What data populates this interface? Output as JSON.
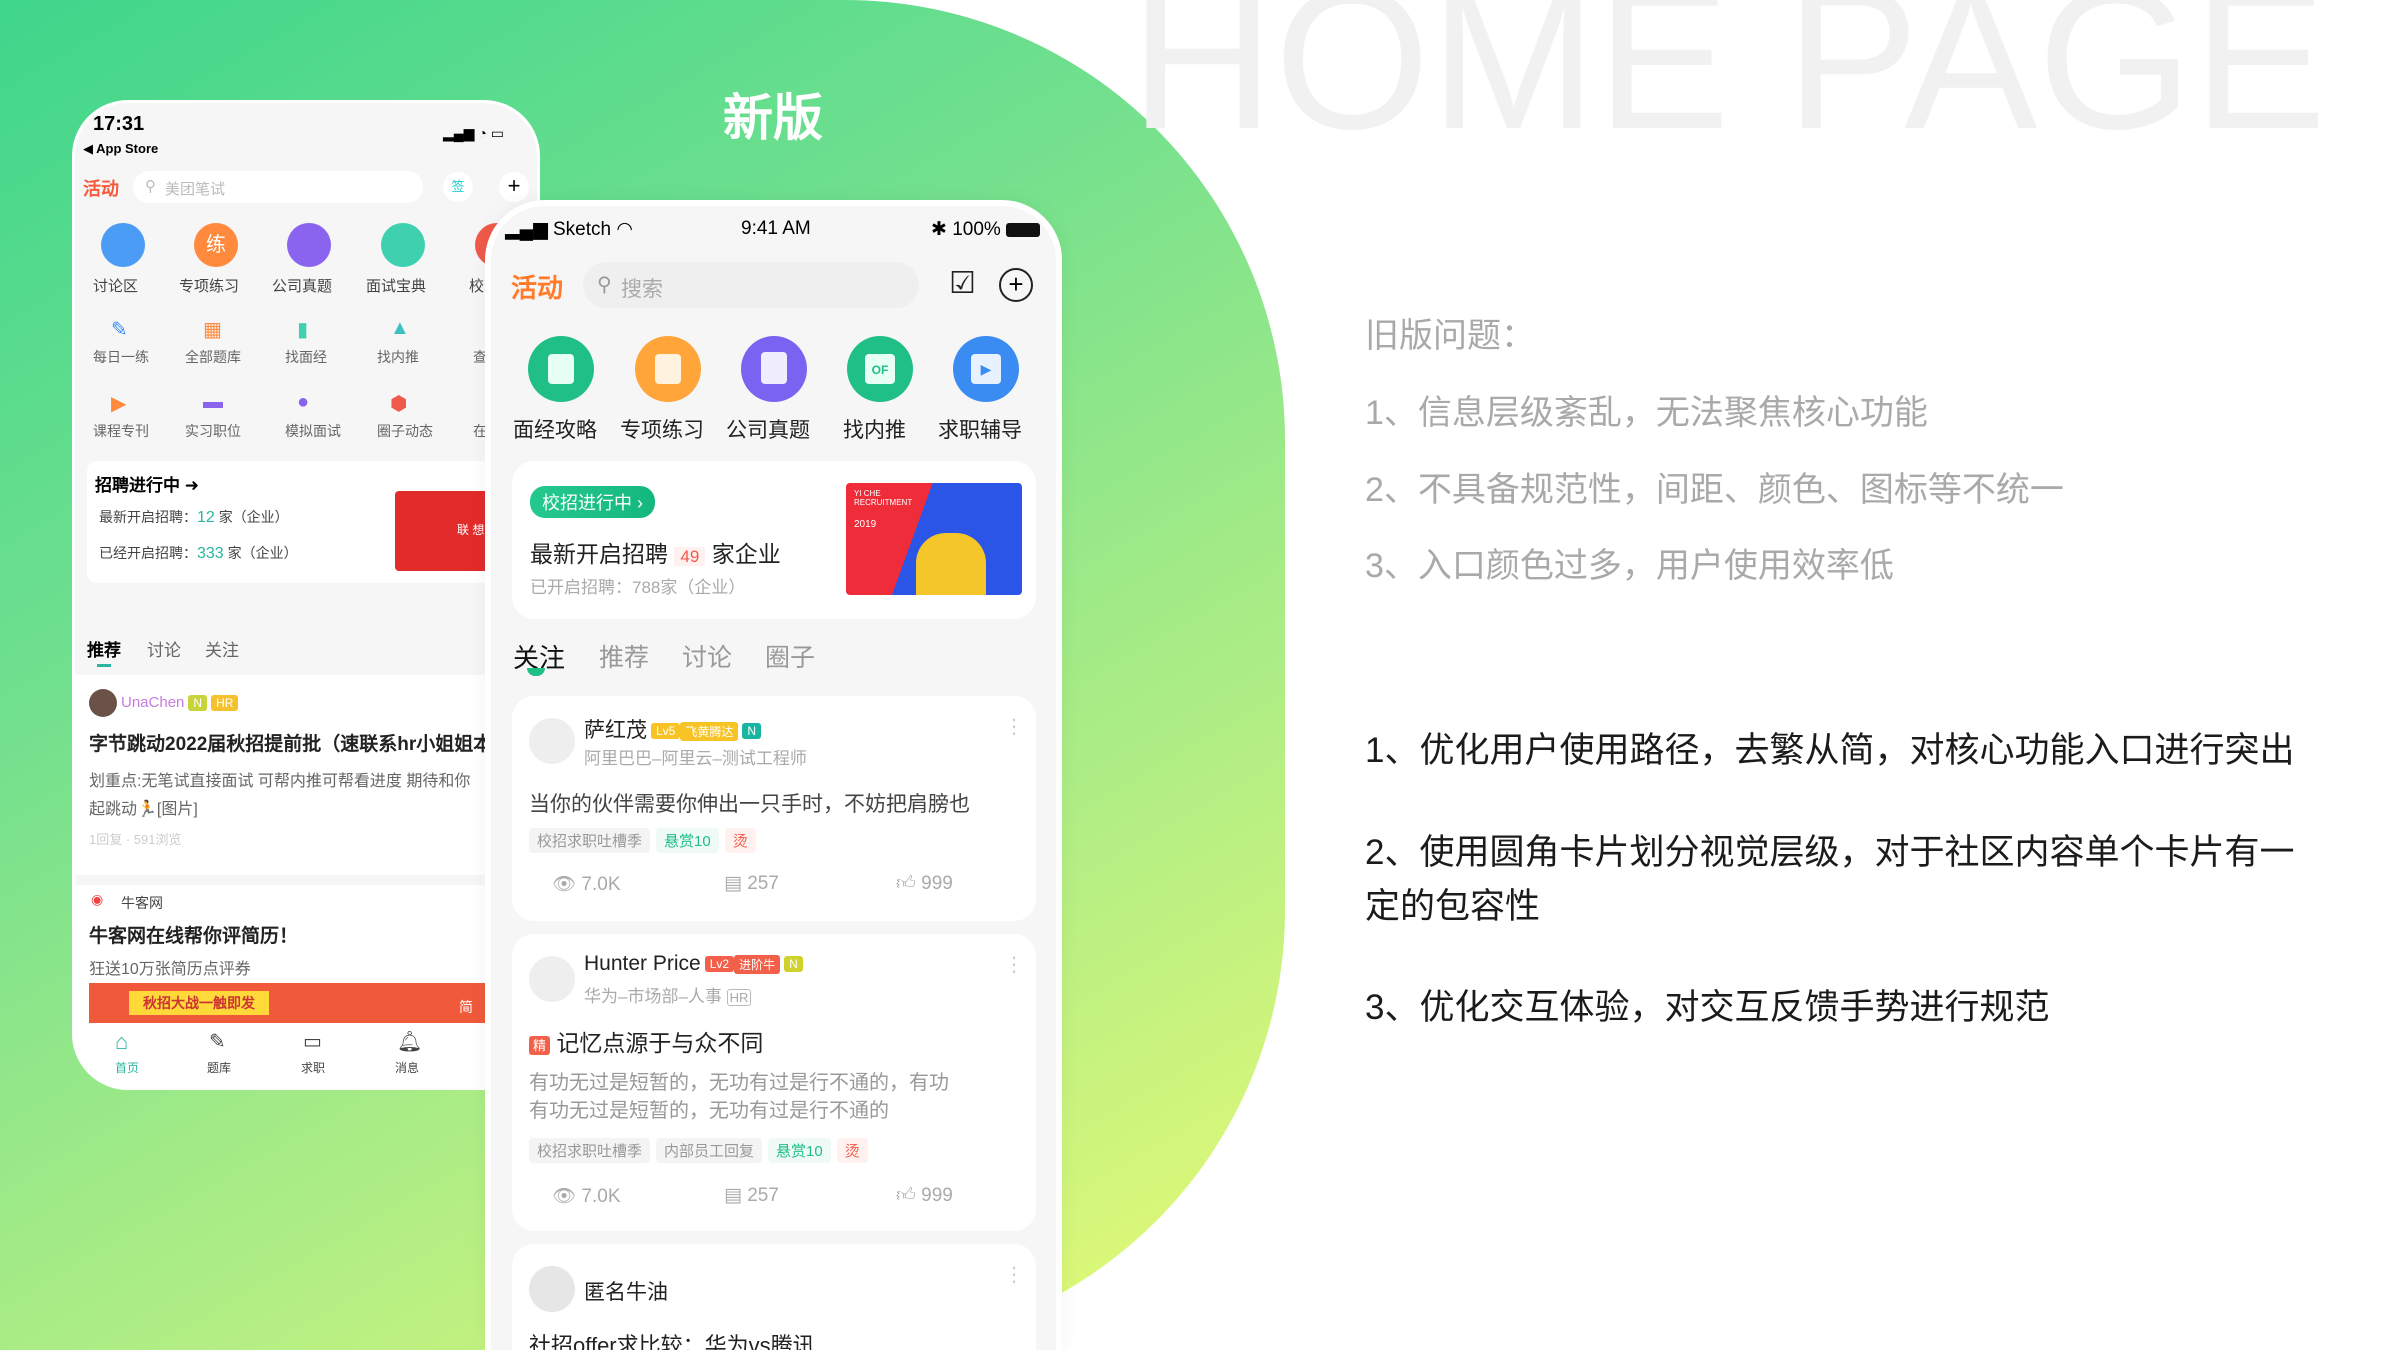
{
  "slide": {
    "watermark": "HOME PAGE",
    "new_label": "新版"
  },
  "colors": {
    "brand_green": "#1fc085",
    "panel_start": "#3fd68c",
    "panel_end": "#eafb74",
    "accent_red": "#f25a4a"
  },
  "old_app": {
    "status": {
      "time": "17:31",
      "back": "◀ App Store"
    },
    "activity_logo": "活动",
    "search_placeholder": "美团笔试",
    "main_icons": [
      {
        "label": "讨论区",
        "icon": "chat-icon"
      },
      {
        "label": "专项练习",
        "icon": "practice-icon"
      },
      {
        "label": "公司真题",
        "icon": "building-icon"
      },
      {
        "label": "面试宝典",
        "icon": "book-icon"
      },
      {
        "label": "校",
        "icon": "school-icon"
      }
    ],
    "row2": [
      "每日一练",
      "全部题库",
      "找面经",
      "找内推",
      "查"
    ],
    "row3": [
      "课程专刊",
      "实习职位",
      "模拟面试",
      "圈子动态",
      "在"
    ],
    "recruit": {
      "title": "招聘进行中",
      "line1_prefix": "最新开启招聘：",
      "line1_count": "12",
      "line1_suffix": "家（企业）",
      "line2_prefix": "已经开启招聘：",
      "line2_count": "333",
      "line2_suffix": "家（企业）",
      "banner_text": "联 想"
    },
    "tabs": [
      "推荐",
      "讨论",
      "关注"
    ],
    "post1": {
      "author": "UnaChen",
      "badges": [
        "N",
        "HR"
      ],
      "title": "字节跳动2022届秋招提前批（速联系hr小姐姐本",
      "desc1": "划重点:无笔试直接面试 可帮内推可帮看进度 期待和你",
      "desc2": "起跳动🏃[图片]",
      "meta": "1回复 · 591浏览"
    },
    "post2": {
      "source": "牛客网",
      "title": "牛客网在线帮你评简历！",
      "desc": "狂送10万张简历点评券",
      "banner": "秋招大战一触即发",
      "banner_side": "简"
    },
    "nav": [
      "首页",
      "题库",
      "求职",
      "消息"
    ]
  },
  "new_app": {
    "status": {
      "carrier": "Sketch",
      "time": "9:41 AM",
      "battery": "100%"
    },
    "activity_logo": "活动",
    "search_placeholder": "搜索",
    "icons": [
      {
        "label": "面经攻略",
        "color": "#1fbf86"
      },
      {
        "label": "专项练习",
        "color": "#ffa53a"
      },
      {
        "label": "公司真题",
        "color": "#7a63f0"
      },
      {
        "label": "找内推",
        "color": "#1fbf86"
      },
      {
        "label": "求职辅导",
        "color": "#3b8cf2"
      }
    ],
    "icon_of_text": "OF",
    "campaign": {
      "pill": "校招进行中 ›",
      "title_prefix": "最新开启招聘",
      "count": "49",
      "title_suffix": "家企业",
      "sub": "已开启招聘：788家（企业）",
      "poster_title": "YI CHE RECRUITMENT",
      "poster_year": "2019"
    },
    "tabs": [
      "关注",
      "推荐",
      "讨论",
      "圈子"
    ],
    "posts": [
      {
        "author": "萨红茂",
        "level": "Lv5",
        "level_name": "飞黄腾达",
        "badge": "N",
        "company": "阿里巴巴–阿里云–测试工程师",
        "body": "当你的伙伴需要你伸出一只手时，不妨把肩膀也",
        "tags": [
          "校招求职吐槽季"
        ],
        "reward": "悬赏10",
        "hot": "烫",
        "views": "7.0K",
        "comments": "257",
        "likes": "999"
      },
      {
        "author": "Hunter Price",
        "level": "Lv2",
        "level_name": "进阶牛",
        "badge": "N",
        "company": "华为–市场部–人事",
        "hr": "HR",
        "essence": "精",
        "title": "记忆点源于与众不同",
        "body1": "有功无过是短暂的，无功有过是行不通的，有功",
        "body2": "有功无过是短暂的，无功有过是行不通的",
        "tags": [
          "校招求职吐槽季",
          "内部员工回复"
        ],
        "reward": "悬赏10",
        "hot": "烫",
        "views": "7.0K",
        "comments": "257",
        "likes": "999"
      },
      {
        "author": "匿名牛油",
        "title": "社招offer求比较：华为vs腾讯"
      }
    ]
  },
  "notes": {
    "old_heading": "旧版问题：",
    "old_items": [
      "1、信息层级紊乱，无法聚焦核心功能",
      "2、不具备规范性，间距、颜色、图标等不统一",
      "3、入口颜色过多，用户使用效率低"
    ],
    "new_items": [
      "1、优化用户使用路径，去繁从简，对核心功能入口进行突出",
      "2、使用圆角卡片划分视觉层级，对于社区内容单个卡片有一",
      "定的包容性",
      "3、优化交互体验，对交互反馈手势进行规范"
    ]
  }
}
